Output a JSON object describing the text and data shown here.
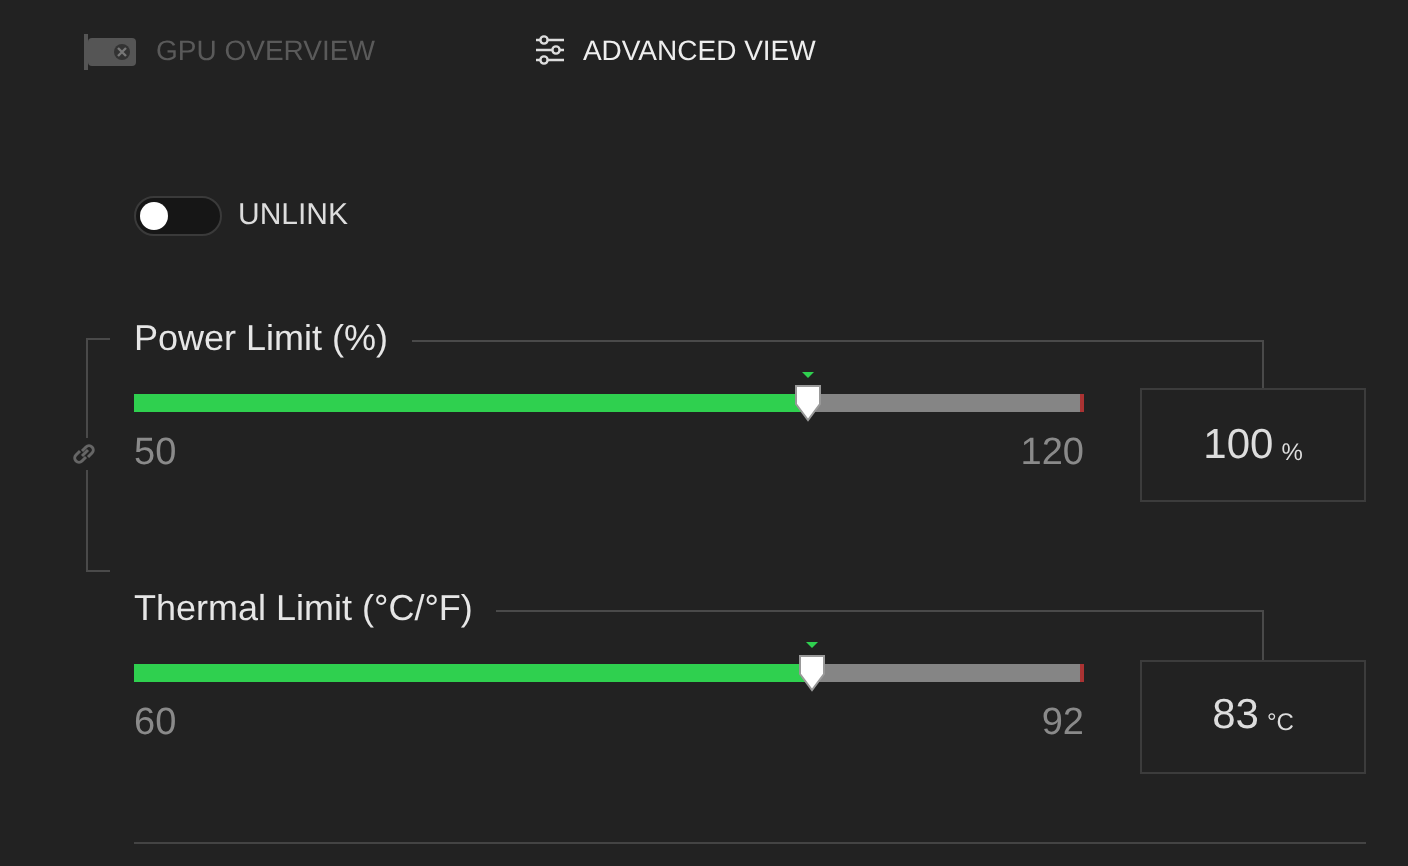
{
  "tabs": [
    {
      "label": "GPU OVERVIEW",
      "kind": "gpu",
      "selected": false
    },
    {
      "label": "ADVANCED VIEW",
      "kind": "sliders",
      "selected": true
    }
  ],
  "unlink_toggle": {
    "label": "UNLINK",
    "on": false
  },
  "sliders": [
    {
      "label": "Power Limit (%)",
      "level": 0.71,
      "min": "50",
      "max": "120",
      "value": "100",
      "unit": "%"
    },
    {
      "label": "Thermal Limit (°C/°F)",
      "level": 0.713,
      "min": "60",
      "max": "92",
      "value": "83",
      "unit": "°C"
    }
  ]
}
